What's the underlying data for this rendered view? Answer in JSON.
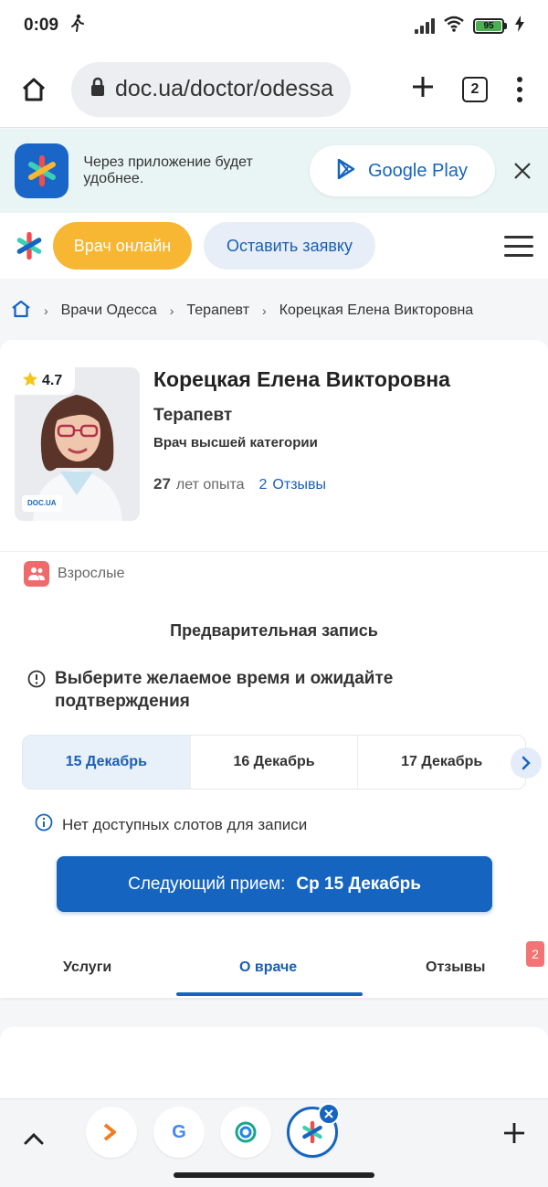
{
  "status": {
    "time": "0:09",
    "battery": "95"
  },
  "browser": {
    "url": "doc.ua/doctor/odessa",
    "tab_count": "2"
  },
  "banner": {
    "text": "Через приложение будет удобнее.",
    "store_label": "Google Play"
  },
  "header": {
    "online_label": "Врач онлайн",
    "request_label": "Оставить заявку"
  },
  "breadcrumb": {
    "items": [
      "Врачи Одесса",
      "Терапевт",
      "Корецкая Елена Викторовна"
    ]
  },
  "doctor": {
    "rating": "4.7",
    "name": "Корецкая Елена Викторовна",
    "specialty": "Терапевт",
    "category": "Врач высшей категории",
    "experience_years": "27",
    "experience_label": "лет опыта",
    "reviews_count": "2",
    "reviews_label": "Отзывы",
    "age_group": "Взрослые",
    "photo_watermark": "DOC.UA"
  },
  "booking": {
    "title": "Предварительная запись",
    "notice": "Выберите желаемое время и ожидайте подтверждения",
    "dates": [
      {
        "label": "15 Декабрь",
        "active": true
      },
      {
        "label": "16 Декабрь",
        "active": false
      },
      {
        "label": "17 Декабрь",
        "active": false
      }
    ],
    "no_slots": "Нет доступных слотов для записи",
    "next_label": "Следующий прием:",
    "next_date": "Ср 15 Декабрь"
  },
  "tabs": {
    "items": [
      "Услуги",
      "О враче",
      "Отзывы"
    ],
    "active_index": 1,
    "reviews_badge": "2"
  },
  "colors": {
    "primary": "#1565c0",
    "accent_orange": "#f7b733",
    "badge_red": "#f27474"
  },
  "icons": {
    "status": [
      "walking-icon",
      "signal-icon",
      "wifi-icon",
      "battery-icon",
      "charging-icon"
    ],
    "browser": [
      "home-icon",
      "lock-icon",
      "plus-icon",
      "tabs-icon",
      "menu-dots-icon"
    ],
    "bottom": [
      "chevron-up-icon",
      "tab-app-orange-icon",
      "tab-google-icon",
      "tab-app-green-icon",
      "tab-docua-icon",
      "close-icon",
      "plus-icon"
    ]
  }
}
